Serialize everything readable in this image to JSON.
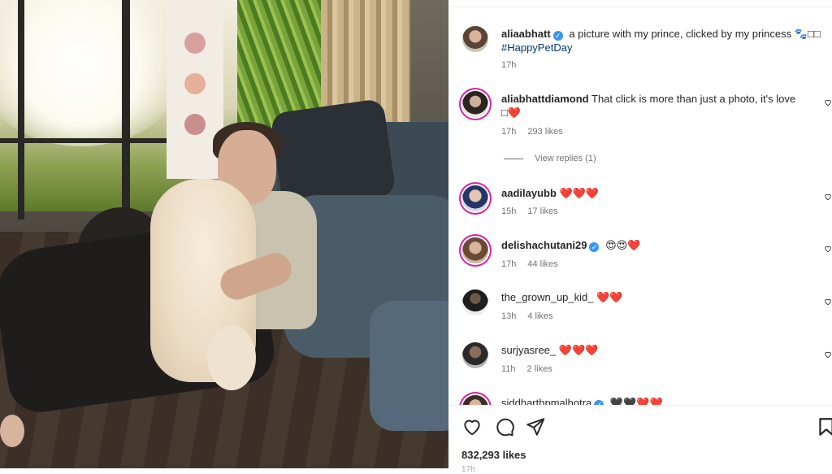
{
  "post": {
    "author": "aliaabhatt",
    "caption": "a picture with my prince, clicked by my princess",
    "caption_emoji": "🐾",
    "caption_trailing": "🐾□□",
    "hashtag": "#HappyPetDay",
    "time": "17h"
  },
  "comments": [
    {
      "user": "aliabhattdiamond",
      "verified": false,
      "text": "That click is more than just a photo, it's love",
      "text2": "□❤️",
      "time": "17h",
      "likes": "293 likes"
    },
    {
      "user": "aadilayubb",
      "verified": false,
      "text": "❤️❤️❤️",
      "time": "15h",
      "likes": "17 likes"
    },
    {
      "user": "delishachutani29",
      "verified": true,
      "text": "😍😍❤️",
      "time": "17h",
      "likes": "44 likes"
    },
    {
      "user": "the_grown_up_kid_",
      "verified": false,
      "text": "❤️❤️",
      "time": "13h",
      "likes": "4 likes"
    },
    {
      "user": "surjyasree_",
      "verified": false,
      "text": "❤️❤️❤️",
      "time": "11h",
      "likes": "2 likes"
    },
    {
      "user": "siddharthpmalhotra",
      "verified": true,
      "text": "🖤🖤❤️❤️",
      "time": "",
      "likes": ""
    }
  ],
  "view_replies": "View replies (1)",
  "likes_count": "832,293 likes",
  "icons": [
    "heart-icon",
    "comment-icon",
    "share-icon",
    "bookmark-icon"
  ],
  "colors": {
    "ring": "#d6249f",
    "verified": "#3897f0",
    "heart": "#e0245e",
    "hashtag": "#00376b"
  }
}
